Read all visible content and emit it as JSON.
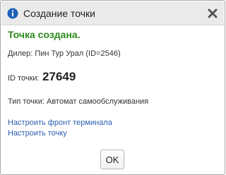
{
  "dialog": {
    "title": "Создание точки",
    "info_icon": "info-icon",
    "close_icon": "close-icon"
  },
  "content": {
    "success_message": "Точка создана.",
    "dealer_text": "Дилер: Пин Тур Урал (ID=2546)",
    "point_id_label": "ID точки:",
    "point_id_value": "27649",
    "point_type_text": "Тип точки: Автомат самообслуживания"
  },
  "links": {
    "configure_front": "Настроить фронт терминала",
    "configure_point": "Настроить точку"
  },
  "buttons": {
    "ok_label": "OK"
  },
  "colors": {
    "success": "#2e8b1e",
    "link": "#2a5db0",
    "info_icon": "#1d5fb8",
    "titlebar": "#eaeaea"
  }
}
